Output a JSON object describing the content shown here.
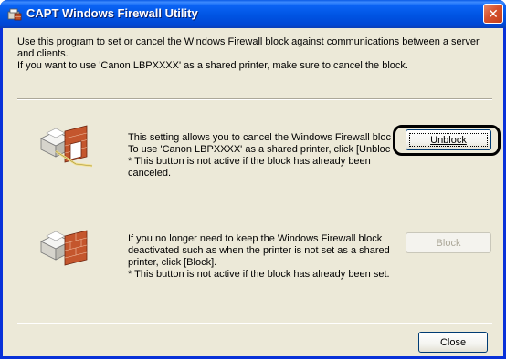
{
  "window": {
    "title": "CAPT Windows Firewall Utility",
    "close_glyph": "✕",
    "icon": "capt-app-icon"
  },
  "intro": {
    "line1": "Use this program to set or cancel the Windows Firewall block against communications between a server",
    "line2": "and clients.",
    "line3": "If you want to use 'Canon LBPXXXX' as a shared printer, make sure to cancel the block."
  },
  "unblock_section": {
    "icon": "printer-firewall-unblocked-icon",
    "lines": [
      "This setting allows you to cancel the Windows Firewall bloc",
      "To use 'Canon LBPXXXX' as a shared printer, click [Unblock",
      "* This button is not active if the block has already been",
      "canceled."
    ],
    "button_label": "Unblock",
    "button_enabled": true
  },
  "block_section": {
    "icon": "printer-firewall-blocked-icon",
    "lines": [
      "If you no longer need to keep the Windows Firewall block",
      "deactivated such as when the printer is not set as a shared",
      "printer, click [Block].",
      "* This button is not active if the block has already been set."
    ],
    "button_label": "Block",
    "button_enabled": false
  },
  "footer": {
    "close_label": "Close"
  }
}
